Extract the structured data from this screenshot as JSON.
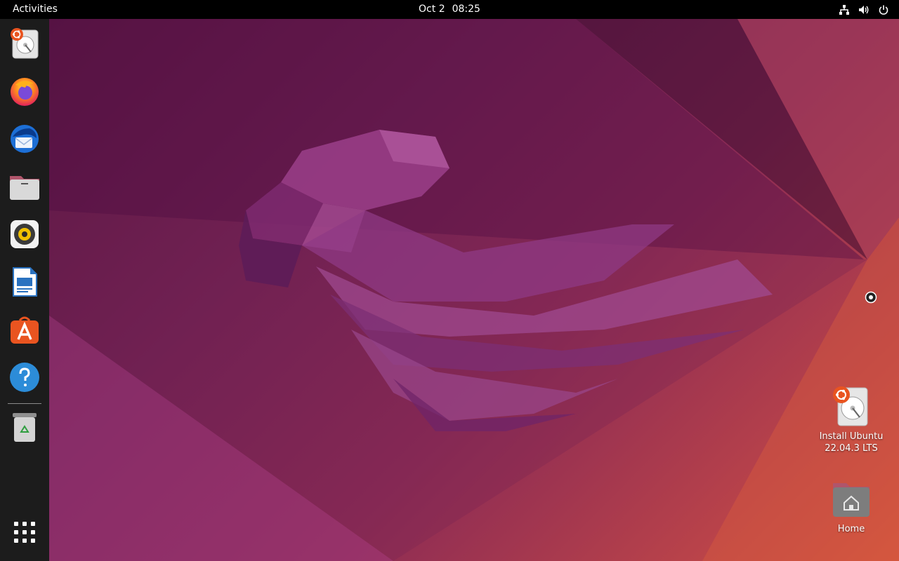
{
  "topbar": {
    "activities_label": "Activities",
    "date": "Oct 2",
    "time": "08:25",
    "status_icons": [
      "network-wired-icon",
      "volume-icon",
      "power-icon"
    ]
  },
  "dock": {
    "items": [
      {
        "name": "install-ubuntu",
        "icon": "ubuntu-installer-icon"
      },
      {
        "name": "firefox",
        "icon": "firefox-icon"
      },
      {
        "name": "thunderbird",
        "icon": "thunderbird-icon"
      },
      {
        "name": "files",
        "icon": "files-icon"
      },
      {
        "name": "rhythmbox",
        "icon": "rhythmbox-icon"
      },
      {
        "name": "libreoffice-writer",
        "icon": "libreoffice-writer-icon"
      },
      {
        "name": "ubuntu-software",
        "icon": "ubuntu-software-icon"
      },
      {
        "name": "help",
        "icon": "help-icon"
      },
      {
        "name": "trash",
        "icon": "trash-icon"
      }
    ],
    "show_apps_icon": "app-grid-icon"
  },
  "desktop": {
    "icons": [
      {
        "label_line1": "Install Ubuntu",
        "label_line2": "22.04.3 LTS",
        "icon": "ubuntu-installer-icon"
      },
      {
        "label_line1": "Home",
        "icon": "home-folder-icon"
      }
    ]
  },
  "colors": {
    "accent": "#e95420",
    "topbar_bg": "#000000",
    "dock_bg": "#1c1c1c",
    "wallpaper_dark": "#4a0f3c",
    "wallpaper_orange": "#d2543f"
  }
}
